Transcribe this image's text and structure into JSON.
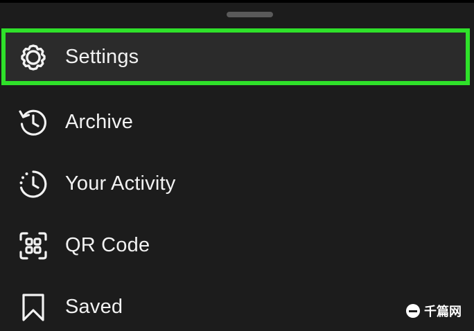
{
  "menu": {
    "items": [
      {
        "label": "Settings",
        "icon": "gear-icon",
        "highlighted": true
      },
      {
        "label": "Archive",
        "icon": "history-icon",
        "highlighted": false
      },
      {
        "label": "Your Activity",
        "icon": "activity-icon",
        "highlighted": false
      },
      {
        "label": "QR Code",
        "icon": "qr-code-icon",
        "highlighted": false
      },
      {
        "label": "Saved",
        "icon": "bookmark-icon",
        "highlighted": false
      }
    ]
  },
  "watermark": {
    "text": "千篇网"
  },
  "colors": {
    "background": "#1c1c1c",
    "highlight_border": "#2fe12a",
    "text": "#f2f2f2"
  }
}
